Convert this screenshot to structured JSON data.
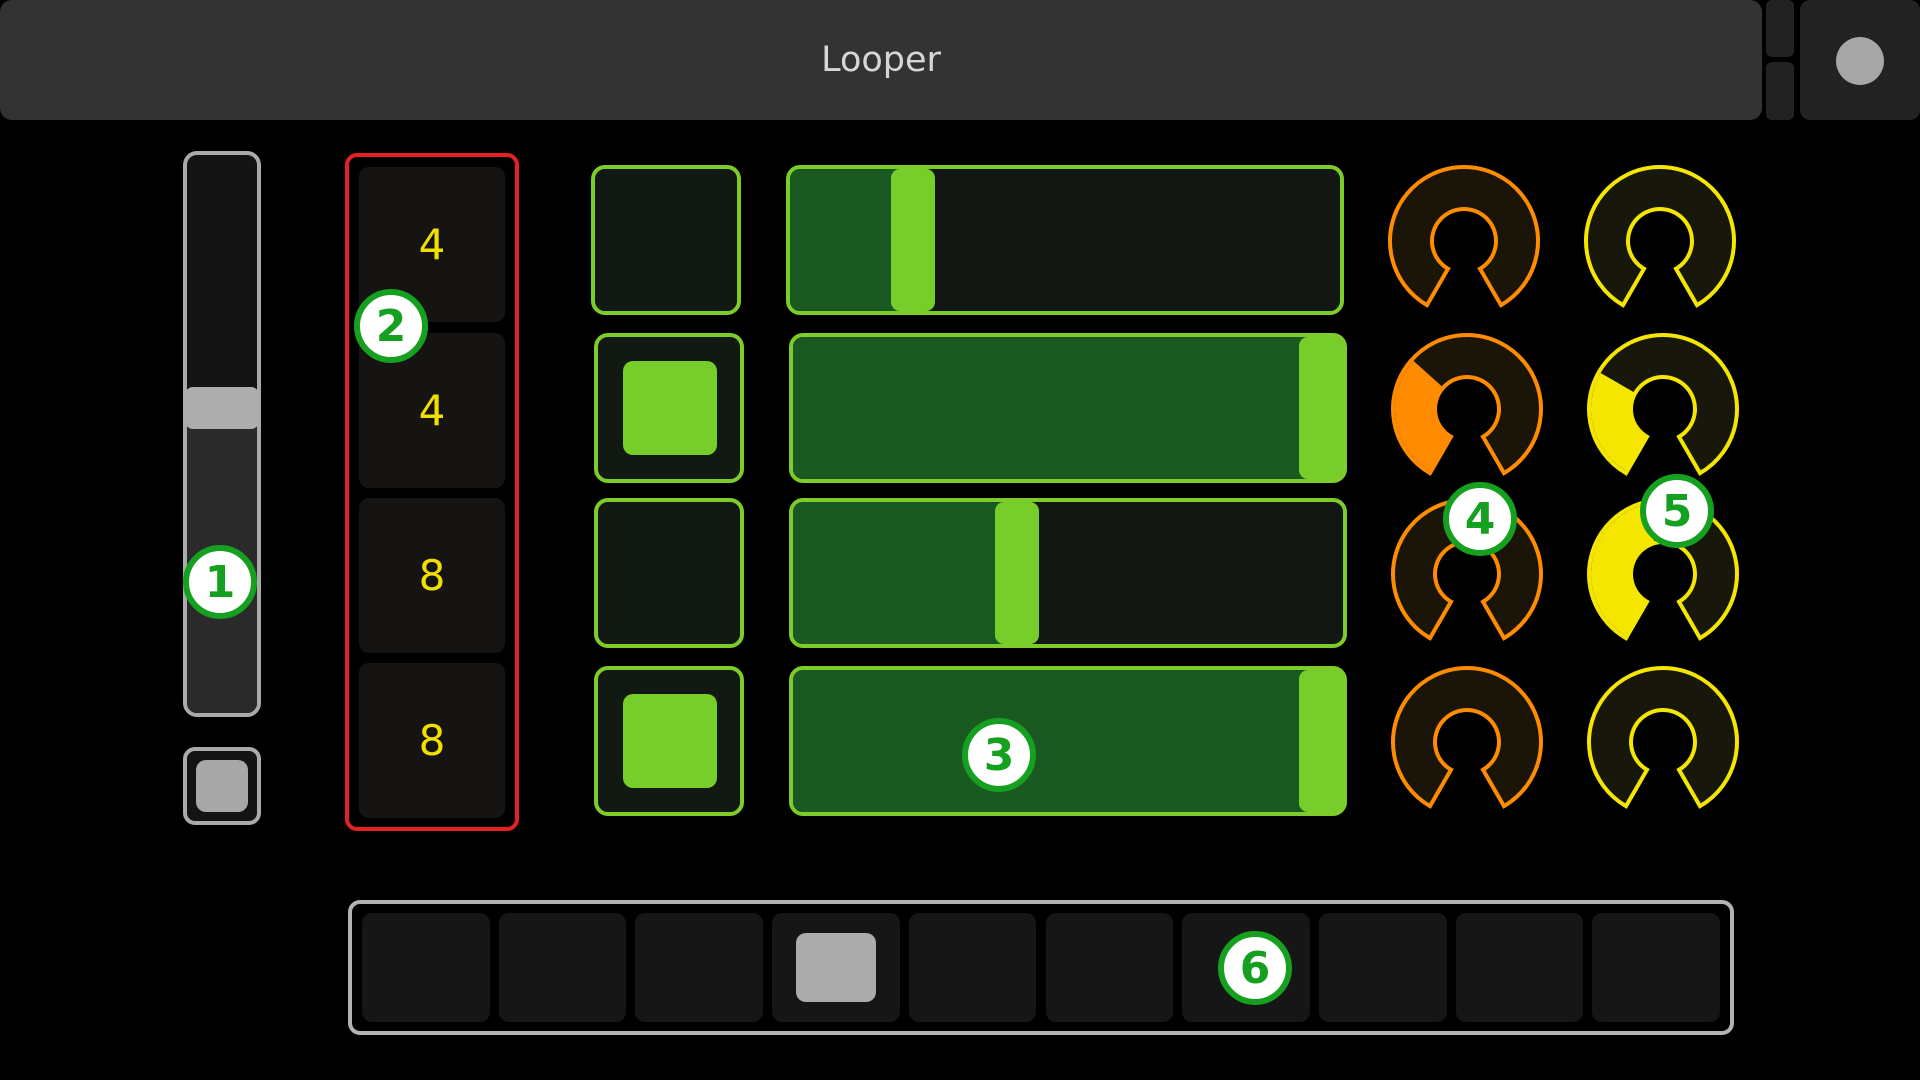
{
  "app": {
    "title": "Looper"
  },
  "colors": {
    "accent_green": "#77cd2a",
    "loop_length_border": "#e52222",
    "loop_length_text": "#f0e000",
    "knob_orange": "#ff8c00",
    "knob_yellow": "#f5e600",
    "badge_green": "#16a020"
  },
  "volume": {
    "level": 0.55
  },
  "loop_lengths": [
    "4",
    "4",
    "8",
    "8"
  ],
  "tracks": [
    {
      "toggle_on": false,
      "position": 0.2,
      "knob_a": 0.0,
      "knob_b": 0.0
    },
    {
      "toggle_on": true,
      "position": 1.0,
      "knob_a": 0.34,
      "knob_b": 0.3
    },
    {
      "toggle_on": false,
      "position": 0.4,
      "knob_a": 0.0,
      "knob_b": 0.45
    },
    {
      "toggle_on": true,
      "position": 1.0,
      "knob_a": 0.0,
      "knob_b": 0.0
    }
  ],
  "step_sequencer": {
    "steps": 10,
    "active_step": 3
  },
  "callouts": [
    "1",
    "2",
    "3",
    "4",
    "5",
    "6"
  ]
}
